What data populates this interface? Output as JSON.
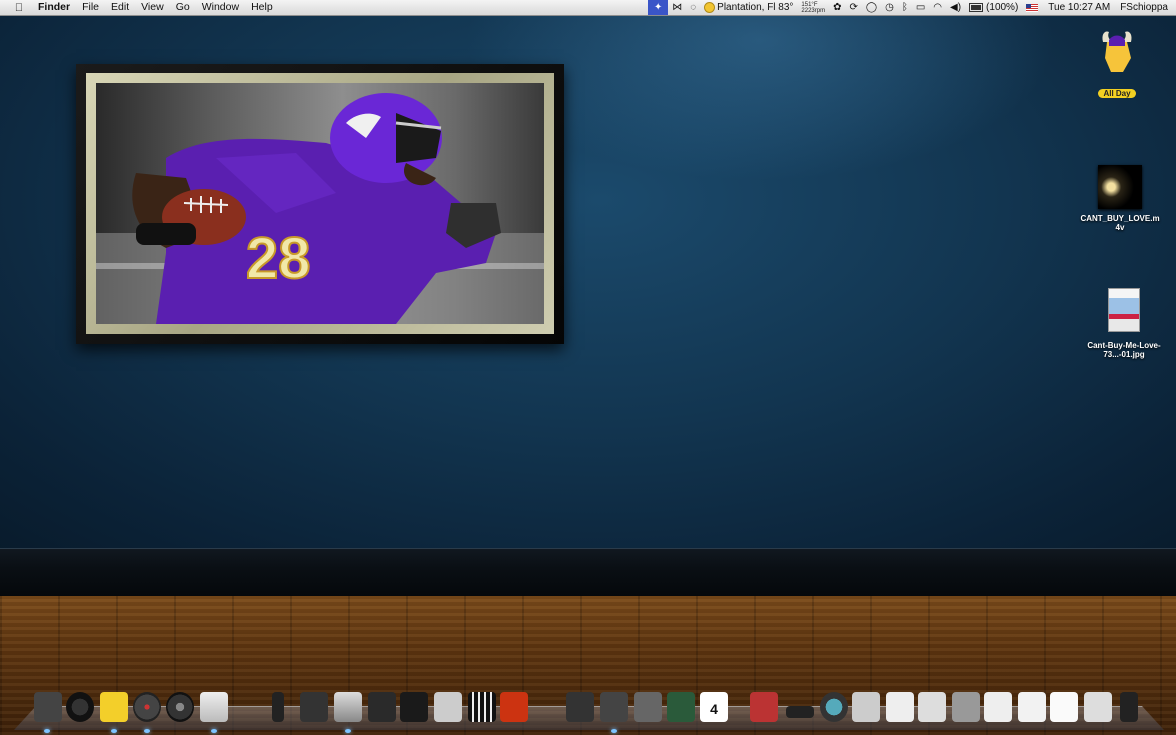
{
  "menubar": {
    "apple_icon": "apple-icon",
    "app_name": "Finder",
    "menus": [
      "File",
      "Edit",
      "View",
      "Go",
      "Window",
      "Help"
    ],
    "weather": "Plantation, Fl 83°",
    "cpu_temp": "151°F",
    "fan_speed": "2223rpm",
    "battery": "(100%)",
    "clock": "Tue 10:27 AM",
    "user": "FSchioppa"
  },
  "desktop": {
    "icons": [
      {
        "name": "vikings-widget",
        "label": "All Day"
      },
      {
        "name": "movie-file",
        "label": "CANT_BUY_LOVE.m4v"
      },
      {
        "name": "image-file",
        "label": "Cant-Buy-Me-Love-73...-01.jpg"
      }
    ],
    "poster_jersey_number": "28"
  },
  "dock": {
    "calendar_day": "4",
    "accent_indicator": "#7ec4ff"
  },
  "colors": {
    "wall": "#123550",
    "floor": "#5e3510",
    "jersey": "#5a1fb0",
    "widget_pill": "#f2d022"
  }
}
